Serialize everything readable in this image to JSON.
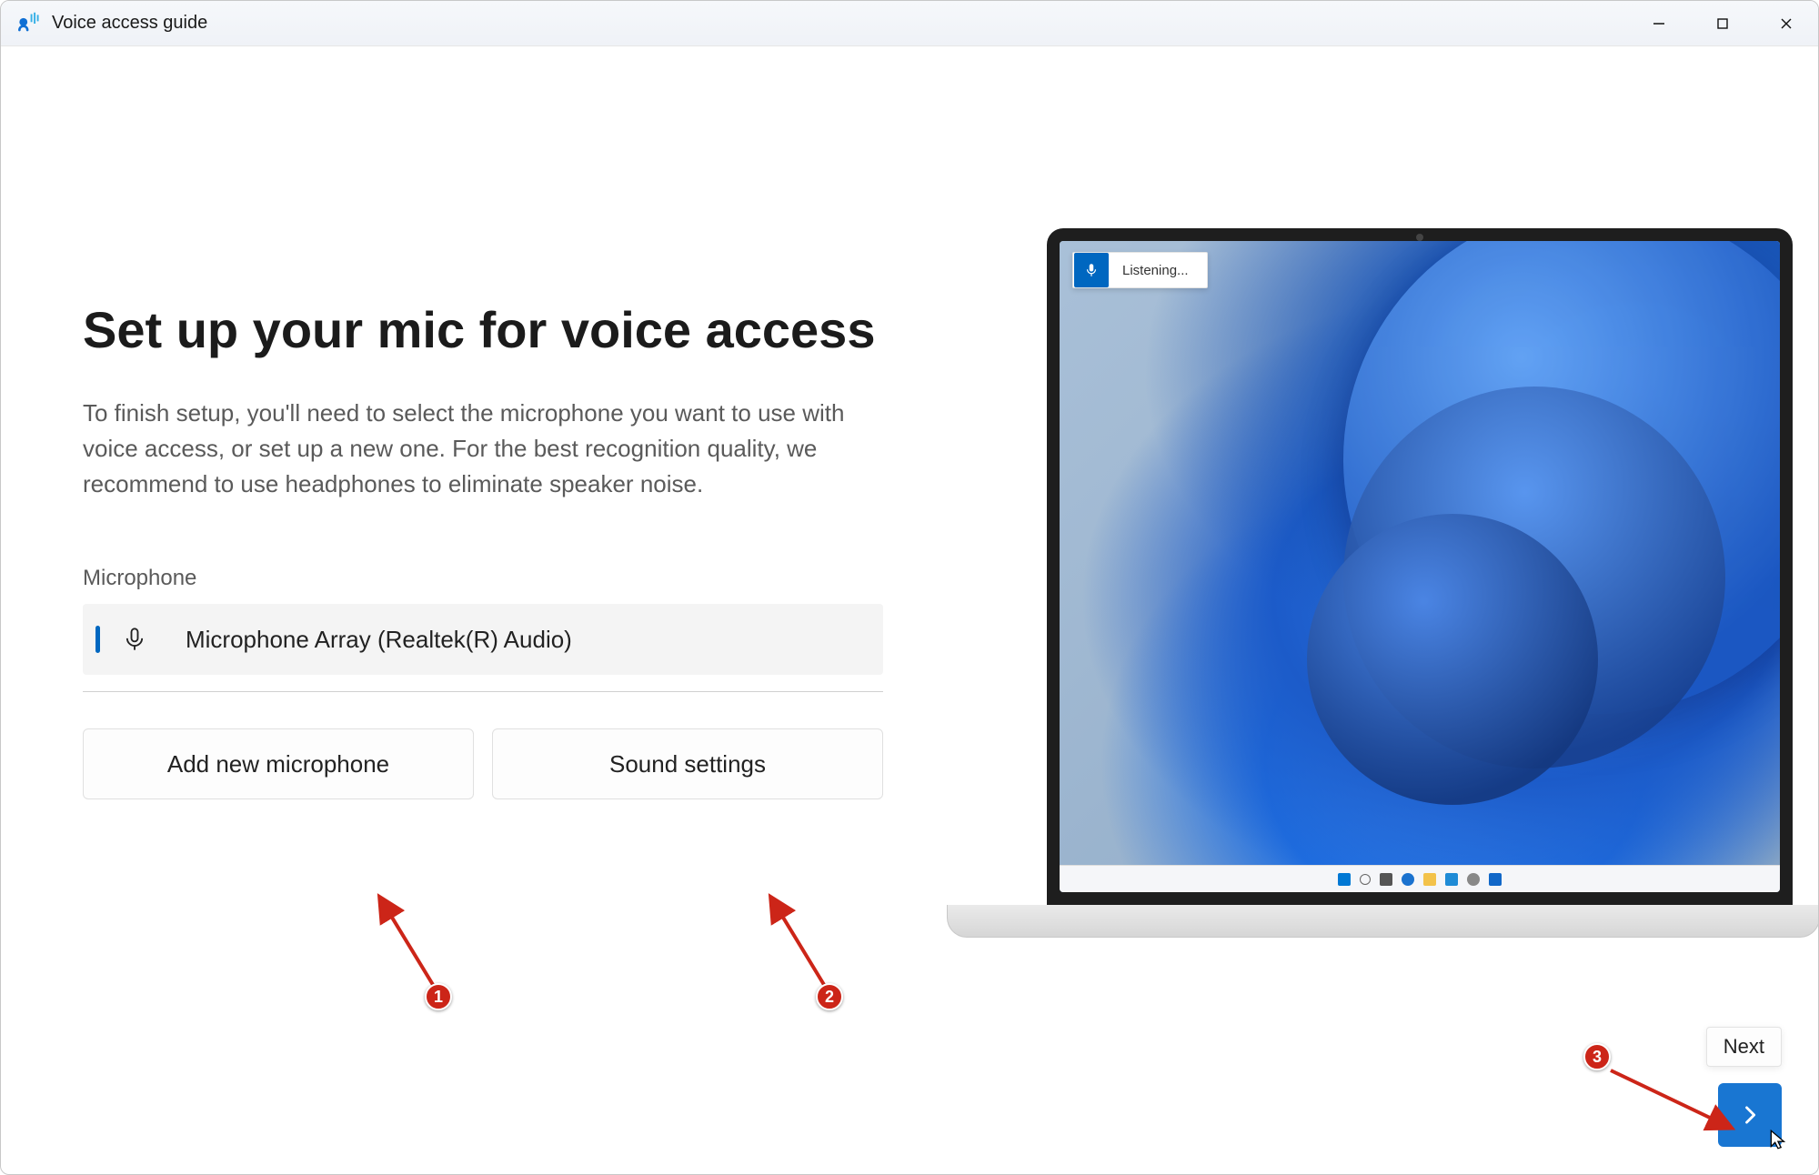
{
  "window": {
    "title": "Voice access guide"
  },
  "main": {
    "heading": "Set up your mic for voice access",
    "description": "To finish setup, you'll need to select the microphone you want to use with voice access, or set up a new one. For the best recognition quality, we recommend to use headphones to eliminate speaker noise.",
    "mic_label": "Microphone",
    "selected_mic": "Microphone Array (Realtek(R) Audio)",
    "add_mic_label": "Add new microphone",
    "sound_settings_label": "Sound settings"
  },
  "illustration": {
    "voice_access_status": "Listening..."
  },
  "next": {
    "tooltip": "Next"
  },
  "annotations": {
    "badge1": "1",
    "badge2": "2",
    "badge3": "3"
  },
  "colors": {
    "accent": "#0067c0",
    "annotation": "#cc2518"
  }
}
